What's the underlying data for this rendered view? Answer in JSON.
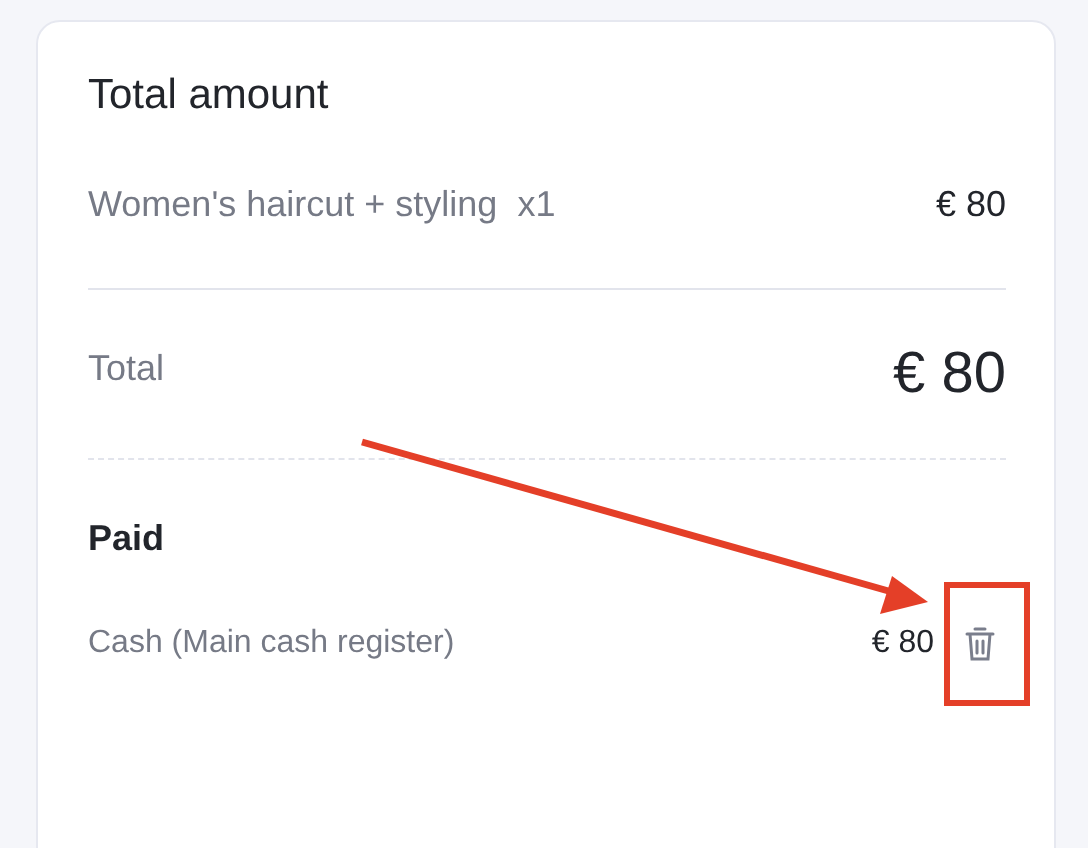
{
  "title": "Total amount",
  "items": [
    {
      "name": "Women's haircut + styling  x1",
      "amount": "€ 80"
    }
  ],
  "total": {
    "label": "Total",
    "amount": "€ 80"
  },
  "paid": {
    "heading": "Paid",
    "payments": [
      {
        "method": "Cash (Main cash register)",
        "amount": "€ 80"
      }
    ]
  }
}
